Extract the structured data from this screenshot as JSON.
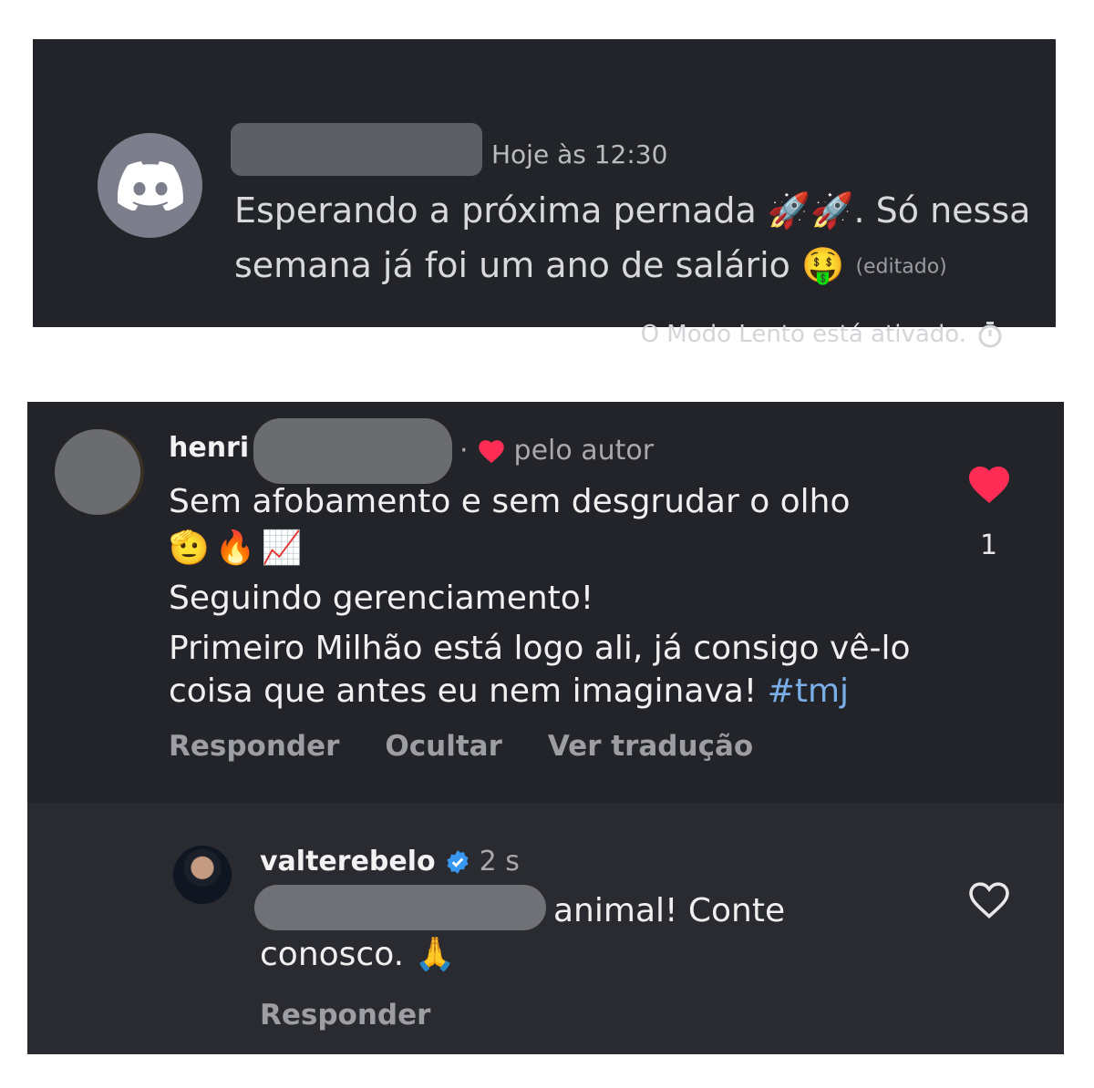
{
  "discord": {
    "timestamp": "Hoje às 12:30",
    "message_part1": "Esperando a próxima pernada ",
    "emoji_rockets": "🚀🚀",
    "message_part2": ". Só nessa semana já foi um ano de salário ",
    "emoji_money": "🤑",
    "edited_label": "(editado)",
    "slowmode_text": "O Modo Lento está ativado.",
    "icons": {
      "avatar": "discord-logo-icon",
      "slowmode": "stopwatch-icon"
    }
  },
  "instagram": {
    "comment": {
      "username_visible": "henri",
      "liked_by_label": "pelo autor",
      "line1": "Sem afobamento e sem desgrudar o olho",
      "emoji_line": "🫡🔥📈",
      "line2": "Seguindo gerenciamento!",
      "line3": "Primeiro Milhão está logo ali, já consigo vê-lo coisa que antes eu nem imaginava! ",
      "hashtag": "#tmj",
      "like_count": "1",
      "actions": {
        "reply": "Responder",
        "hide": "Ocultar",
        "translate": "Ver tradução"
      }
    },
    "reply": {
      "username": "valterebelo",
      "time": "2 s",
      "text_part1": "animal! Conte",
      "text_part2": "conosco. ",
      "emoji": "🙏",
      "action_reply": "Responder"
    },
    "colors": {
      "heart": "#ff2d55",
      "hashtag": "#7aaee8",
      "verified": "#3897f0"
    }
  }
}
